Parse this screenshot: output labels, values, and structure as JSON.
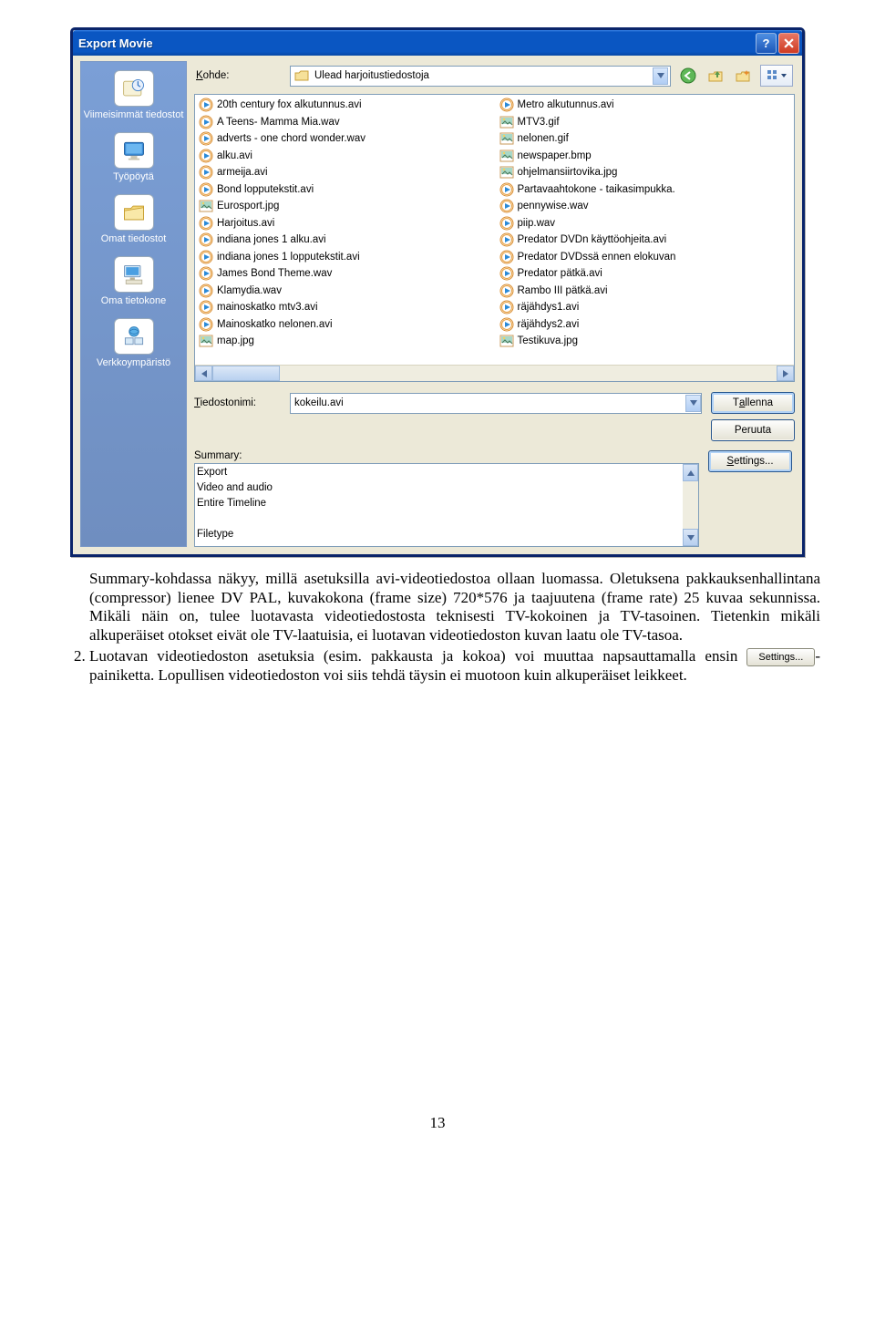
{
  "dialog": {
    "title": "Export Movie",
    "kohde_label": "Kohde:",
    "kohde_value": "Ulead harjoitustiedostoja",
    "sidebar": [
      {
        "label": "Viimeisimmät tiedostot",
        "icon": "recent"
      },
      {
        "label": "Työpöytä",
        "icon": "desktop"
      },
      {
        "label": "Omat tiedostot",
        "icon": "mydocs"
      },
      {
        "label": "Oma tietokone",
        "icon": "mycomputer"
      },
      {
        "label": "Verkkoympäristö",
        "icon": "network"
      }
    ],
    "files": {
      "col1": [
        {
          "name": "20th century fox alkutunnus.avi",
          "type": "media"
        },
        {
          "name": "A Teens- Mamma Mia.wav",
          "type": "media"
        },
        {
          "name": "adverts - one chord wonder.wav",
          "type": "media"
        },
        {
          "name": "alku.avi",
          "type": "media"
        },
        {
          "name": "armeija.avi",
          "type": "media"
        },
        {
          "name": "Bond lopputekstit.avi",
          "type": "media"
        },
        {
          "name": "Eurosport.jpg",
          "type": "image"
        },
        {
          "name": "Harjoitus.avi",
          "type": "media"
        },
        {
          "name": "indiana jones 1 alku.avi",
          "type": "media"
        },
        {
          "name": "indiana jones 1 lopputekstit.avi",
          "type": "media"
        },
        {
          "name": "James Bond Theme.wav",
          "type": "media"
        },
        {
          "name": "Klamydia.wav",
          "type": "media"
        },
        {
          "name": "mainoskatko mtv3.avi",
          "type": "media"
        },
        {
          "name": "Mainoskatko nelonen.avi",
          "type": "media"
        },
        {
          "name": "map.jpg",
          "type": "image"
        }
      ],
      "col2": [
        {
          "name": "Metro alkutunnus.avi",
          "type": "media"
        },
        {
          "name": "MTV3.gif",
          "type": "image"
        },
        {
          "name": "nelonen.gif",
          "type": "image"
        },
        {
          "name": "newspaper.bmp",
          "type": "image"
        },
        {
          "name": "ohjelmansiirtovika.jpg",
          "type": "image"
        },
        {
          "name": "Partavaahtokone - taikasimpukka.",
          "type": "media"
        },
        {
          "name": "pennywise.wav",
          "type": "media"
        },
        {
          "name": "piip.wav",
          "type": "media"
        },
        {
          "name": "Predator DVDn käyttöohjeita.avi",
          "type": "media"
        },
        {
          "name": "Predator DVDssä ennen elokuvan",
          "type": "media"
        },
        {
          "name": "Predator pätkä.avi",
          "type": "media"
        },
        {
          "name": "Rambo III pätkä.avi",
          "type": "media"
        },
        {
          "name": "räjähdys1.avi",
          "type": "media"
        },
        {
          "name": "räjähdys2.avi",
          "type": "media"
        },
        {
          "name": "Testikuva.jpg",
          "type": "image"
        }
      ]
    },
    "filename_label": "Tiedostonimi:",
    "filename_value": "kokeilu.avi",
    "save_label": "Tallenna",
    "cancel_label": "Peruuta",
    "settings_label": "Settings...",
    "summary_label": "Summary:",
    "summary_lines": [
      "Export",
      "Video and audio",
      "Entire Timeline",
      "",
      "Filetype"
    ]
  },
  "doc": {
    "list_start": "2.",
    "p1_a": "Summary-kohdassa näkyy, millä asetuksilla avi-videotiedostoa ollaan luomassa. Oletuksena pakkauksenhallintana (compressor) lienee DV PAL, kuvakokona (frame size) 720*576 ja taajuutena (frame rate) 25 kuvaa sekunnissa. Mikäli näin on, tulee luotavasta videotiedostosta teknisesti TV-kokoinen ja TV-tasoinen. Tietenkin mikäli alkuperäiset otokset eivät ole TV-laatuisia, ei luotavan videotiedoston kuvan laatu ole TV-tasoa.",
    "p2_a": "Luotavan videotiedoston asetuksia (esim. pakkausta ja kokoa) voi muuttaa napsauttamalla ensin",
    "inline_btn": "Settings...",
    "p2_b": "-painiketta. Lopullisen videotiedoston voi siis tehdä täysin ei muotoon kuin alkuperäiset leikkeet.",
    "page_number": "13"
  }
}
